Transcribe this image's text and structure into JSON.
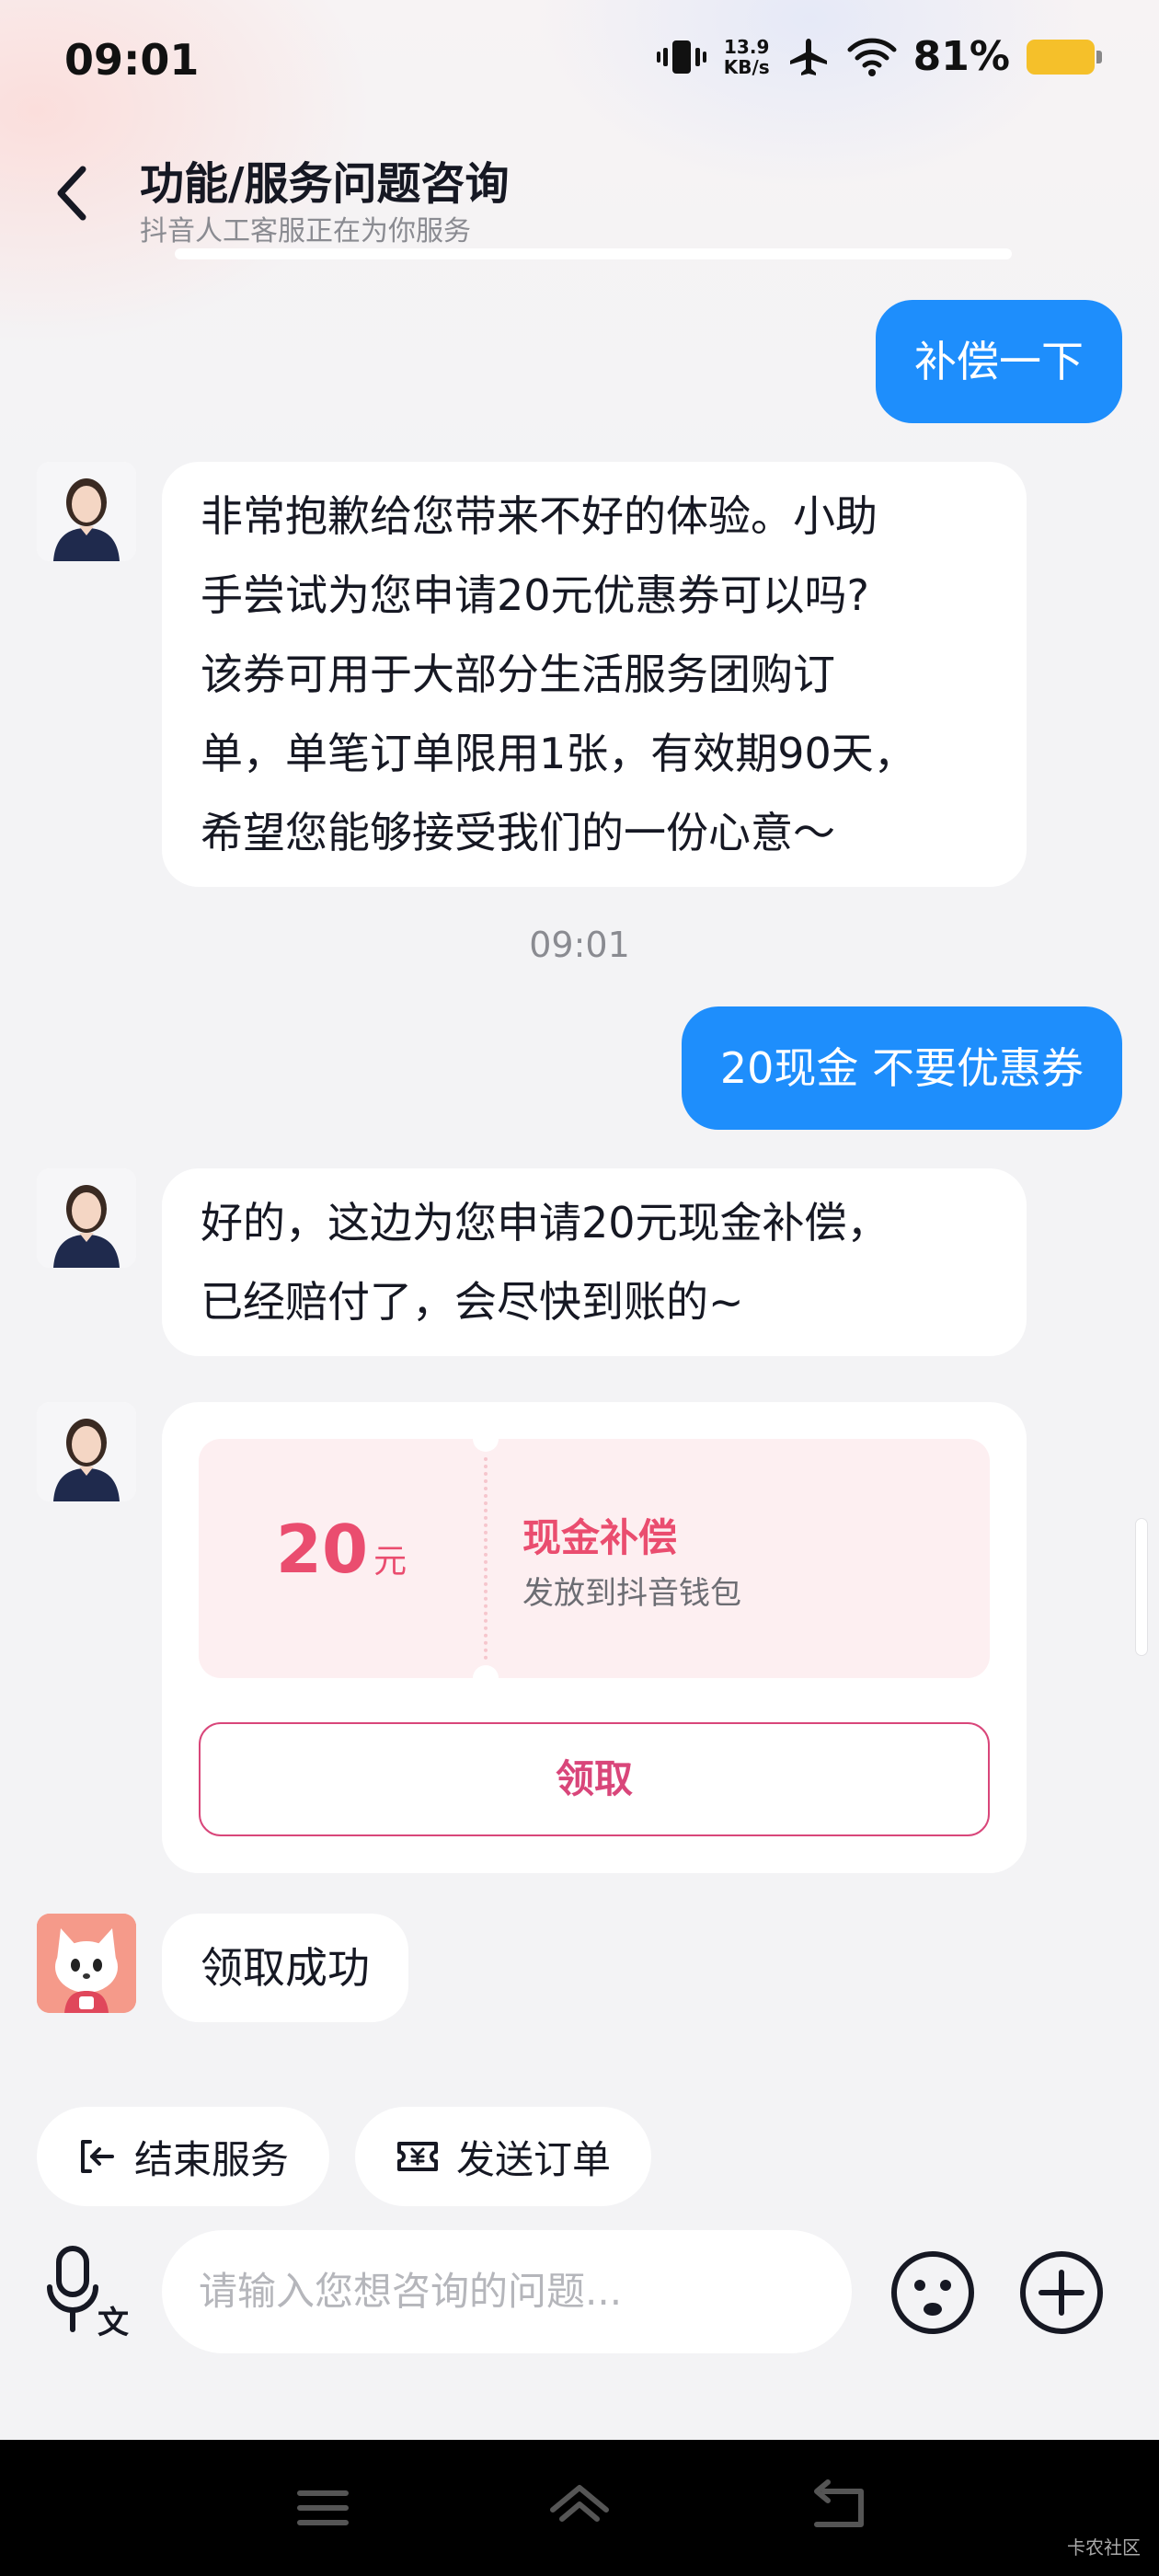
{
  "status_bar": {
    "time": "09:01",
    "net_speed_value": "13.9",
    "net_speed_unit": "KB/s",
    "battery_percent": "81%",
    "battery_level": 0.81,
    "battery_color": "#f5c02a"
  },
  "header": {
    "title": "功能/服务问题咨询",
    "subtitle": "抖音人工客服正在为你服务"
  },
  "messages": [
    {
      "from": "user",
      "text": "补偿一下"
    },
    {
      "from": "agent",
      "lines": [
        "非常抱歉给您带来不好的体验。小助",
        "手尝试为您申请20元优惠券可以吗?",
        "该券可用于大部分生活服务团购订",
        "单，单笔订单限用1张，有效期90天，",
        "希望您能够接受我们的一份心意～"
      ]
    },
    {
      "from": "system",
      "text": "09:01"
    },
    {
      "from": "user",
      "text": "20现金 不要优惠券"
    },
    {
      "from": "agent",
      "lines": [
        "好的，这边为您申请20元现金补偿，",
        "已经赔付了，会尽快到账的~"
      ]
    },
    {
      "from": "agent_card"
    },
    {
      "from": "bot",
      "text": "领取成功"
    }
  ],
  "coupon": {
    "amount": "20",
    "unit": "元",
    "title": "现金补偿",
    "description": "发放到抖音钱包",
    "button_label": "领取",
    "accent_color": "#ea4d6f"
  },
  "quick_actions": [
    {
      "label": "结束服务",
      "icon": "exit-icon"
    },
    {
      "label": "发送订单",
      "icon": "order-icon"
    }
  ],
  "input": {
    "placeholder": "请输入您想咨询的问题..."
  },
  "colors": {
    "user_bubble": "#1e8efc",
    "agent_bubble": "#ffffff",
    "background": "#f3f3f5"
  },
  "watermark": "卡农社区"
}
